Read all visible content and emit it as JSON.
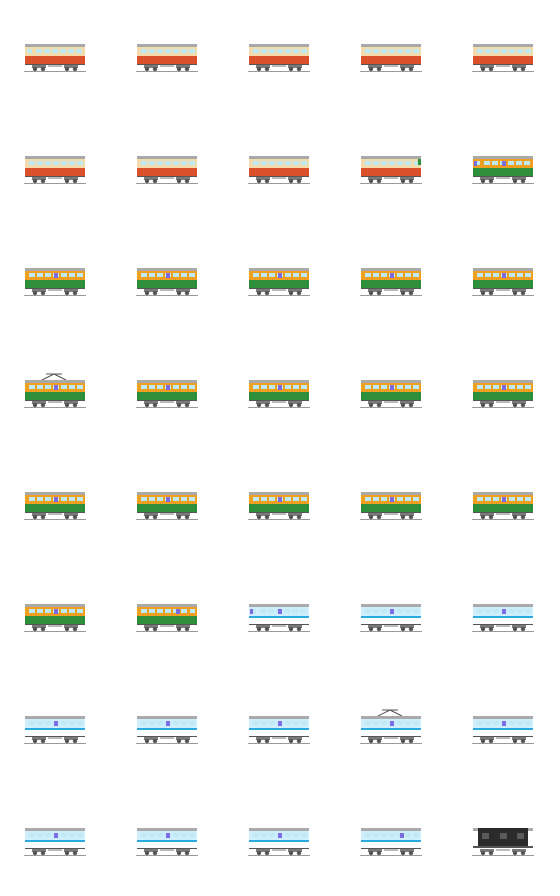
{
  "title": "",
  "palette": {
    "cream": "#f2dcae",
    "red": "#d9502b",
    "orange": "#f0a020",
    "green": "#2f8f3a",
    "white": "#ffffff",
    "skyblue": "#2aa8e0",
    "paleblue": "#cdeefa",
    "roof": "#a9a9a9",
    "under": "#7b7b7b",
    "window": "#bfeaf2",
    "purple": "#7b6ce0",
    "black": "#2b2b2b"
  },
  "items": [
    {
      "name": "express-cab-car",
      "livery": "express",
      "front": "left",
      "cab": true,
      "pantograph": false
    },
    {
      "name": "express-middle-car",
      "livery": "express",
      "front": "none",
      "cab": false,
      "pantograph": false
    },
    {
      "name": "express-middle-car",
      "livery": "express",
      "front": "none",
      "cab": false,
      "pantograph": false
    },
    {
      "name": "express-middle-car",
      "livery": "express",
      "front": "none",
      "cab": false,
      "pantograph": false
    },
    {
      "name": "express-middle-car",
      "livery": "express",
      "front": "none",
      "cab": false,
      "pantograph": false
    },
    {
      "name": "express-middle-car",
      "livery": "express",
      "front": "none",
      "cab": false,
      "pantograph": false
    },
    {
      "name": "express-middle-car",
      "livery": "express",
      "front": "none",
      "cab": false,
      "pantograph": false
    },
    {
      "name": "express-middle-car",
      "livery": "express",
      "front": "none",
      "cab": false,
      "pantograph": false
    },
    {
      "name": "express-cab-car",
      "livery": "express",
      "front": "right",
      "cab": true,
      "pantograph": false
    },
    {
      "name": "shonan-cab-car",
      "livery": "shonan",
      "front": "left",
      "cab": true,
      "pantograph": false
    },
    {
      "name": "shonan-middle-car",
      "livery": "shonan",
      "front": "none",
      "cab": false,
      "pantograph": false
    },
    {
      "name": "shonan-middle-car",
      "livery": "shonan",
      "front": "none",
      "cab": false,
      "pantograph": false
    },
    {
      "name": "shonan-middle-car",
      "livery": "shonan",
      "front": "none",
      "cab": false,
      "pantograph": false
    },
    {
      "name": "shonan-middle-car",
      "livery": "shonan",
      "front": "none",
      "cab": false,
      "pantograph": false
    },
    {
      "name": "shonan-middle-car",
      "livery": "shonan",
      "front": "none",
      "cab": false,
      "pantograph": false
    },
    {
      "name": "shonan-motor-car",
      "livery": "shonan",
      "front": "none",
      "cab": false,
      "pantograph": true
    },
    {
      "name": "shonan-middle-car",
      "livery": "shonan",
      "front": "none",
      "cab": false,
      "pantograph": false
    },
    {
      "name": "shonan-middle-car",
      "livery": "shonan",
      "front": "none",
      "cab": false,
      "pantograph": false
    },
    {
      "name": "shonan-middle-car",
      "livery": "shonan",
      "front": "none",
      "cab": false,
      "pantograph": false
    },
    {
      "name": "shonan-middle-car",
      "livery": "shonan",
      "front": "none",
      "cab": false,
      "pantograph": false
    },
    {
      "name": "shonan-middle-car",
      "livery": "shonan",
      "front": "none",
      "cab": false,
      "pantograph": false
    },
    {
      "name": "shonan-middle-car",
      "livery": "shonan",
      "front": "none",
      "cab": false,
      "pantograph": false
    },
    {
      "name": "shonan-middle-car",
      "livery": "shonan",
      "front": "none",
      "cab": false,
      "pantograph": false
    },
    {
      "name": "shonan-middle-car",
      "livery": "shonan",
      "front": "none",
      "cab": false,
      "pantograph": false
    },
    {
      "name": "shonan-middle-car",
      "livery": "shonan",
      "front": "none",
      "cab": false,
      "pantograph": false
    },
    {
      "name": "shonan-middle-car",
      "livery": "shonan",
      "front": "none",
      "cab": false,
      "pantograph": false
    },
    {
      "name": "shonan-cab-car",
      "livery": "shonan",
      "front": "right",
      "cab": true,
      "pantograph": false
    },
    {
      "name": "blue-cab-car",
      "livery": "blue",
      "front": "left",
      "cab": true,
      "pantograph": false
    },
    {
      "name": "blue-middle-car",
      "livery": "blue",
      "front": "none",
      "cab": false,
      "pantograph": false
    },
    {
      "name": "blue-middle-car",
      "livery": "blue",
      "front": "none",
      "cab": false,
      "pantograph": false
    },
    {
      "name": "blue-middle-car",
      "livery": "blue",
      "front": "none",
      "cab": false,
      "pantograph": false
    },
    {
      "name": "blue-middle-car",
      "livery": "blue",
      "front": "none",
      "cab": false,
      "pantograph": false
    },
    {
      "name": "blue-middle-car",
      "livery": "blue",
      "front": "none",
      "cab": false,
      "pantograph": false
    },
    {
      "name": "blue-motor-car",
      "livery": "blue",
      "front": "none",
      "cab": false,
      "pantograph": true
    },
    {
      "name": "blue-middle-car",
      "livery": "blue",
      "front": "none",
      "cab": false,
      "pantograph": false
    },
    {
      "name": "blue-middle-car",
      "livery": "blue",
      "front": "none",
      "cab": false,
      "pantograph": false
    },
    {
      "name": "blue-middle-car",
      "livery": "blue",
      "front": "none",
      "cab": false,
      "pantograph": false
    },
    {
      "name": "blue-middle-car",
      "livery": "blue",
      "front": "none",
      "cab": false,
      "pantograph": false
    },
    {
      "name": "blue-cab-car",
      "livery": "blue",
      "front": "right",
      "cab": true,
      "pantograph": false
    },
    {
      "name": "black-freight-car",
      "livery": "black",
      "front": "none",
      "cab": false,
      "pantograph": false
    }
  ]
}
